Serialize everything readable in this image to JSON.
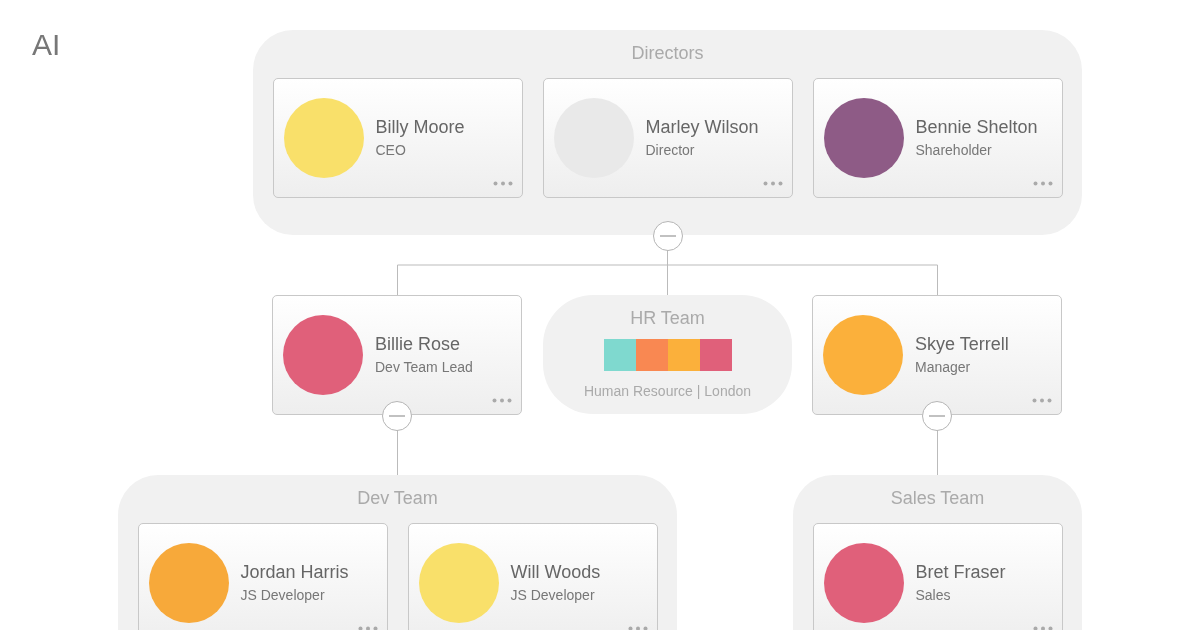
{
  "corner_label": "AI",
  "directors": {
    "title": "Directors",
    "expanded": true,
    "members": [
      {
        "name": "Billy Moore",
        "role": "CEO",
        "color": "#f9e06a"
      },
      {
        "name": "Marley Wilson",
        "role": "Director",
        "color": "#e9e9e9"
      },
      {
        "name": "Bennie Shelton",
        "role": "Shareholder",
        "color": "#8e5b86"
      }
    ]
  },
  "middle_row": [
    {
      "kind": "person",
      "name": "Billie Rose",
      "role": "Dev Team Lead",
      "color": "#e0607a",
      "expanded": true
    },
    {
      "kind": "team",
      "title": "HR Team",
      "subtitle": "Human Resource | London",
      "photos": [
        {
          "color": "#7fd9cf"
        },
        {
          "color": "#f98852"
        },
        {
          "color": "#fbb03b"
        },
        {
          "color": "#e0607a"
        }
      ]
    },
    {
      "kind": "person",
      "name": "Skye Terrell",
      "role": "Manager",
      "color": "#fbb03b",
      "expanded": true
    }
  ],
  "dev_team": {
    "title": "Dev Team",
    "members": [
      {
        "name": "Jordan Harris",
        "role": "JS Developer",
        "color": "#f7a93a"
      },
      {
        "name": "Will Woods",
        "role": "JS Developer",
        "color": "#f9e06a"
      }
    ]
  },
  "sales_team": {
    "title": "Sales Team",
    "members": [
      {
        "name": "Bret Fraser",
        "role": "Sales",
        "color": "#e0607a"
      }
    ]
  }
}
